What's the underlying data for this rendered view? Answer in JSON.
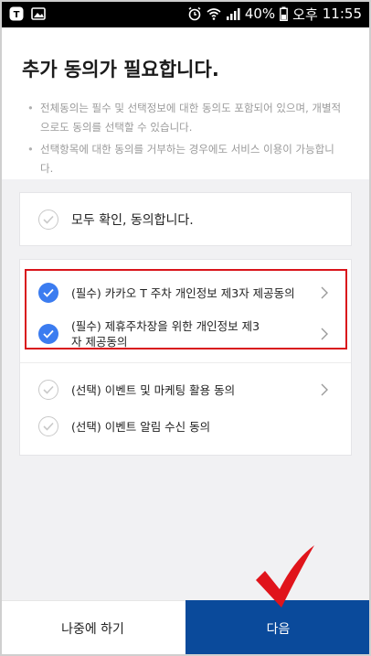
{
  "status_bar": {
    "battery": "40%",
    "time_period": "오후",
    "time": "11:55"
  },
  "title": "추가 동의가 필요합니다.",
  "notes": [
    "전체동의는 필수 및 선택정보에 대한 동의도 포함되어 있으며, 개별적으로도 동의를 선택할 수 있습니다.",
    "선택항목에 대한 동의를 거부하는 경우에도 서비스 이용이 가능합니다."
  ],
  "agree_all": {
    "label": "모두 확인, 동의합니다.",
    "checked": false
  },
  "consents": [
    {
      "label": "(필수) 카카오 T 주차 개인정보 제3자 제공동의",
      "checked": true,
      "has_detail": true
    },
    {
      "label": "(필수) 제휴주차장을 위한 개인정보 제3자 제공동의",
      "checked": true,
      "has_detail": true
    },
    {
      "label": "(선택) 이벤트 및 마케팅 활용 동의",
      "checked": false,
      "has_detail": true
    },
    {
      "label": "(선택) 이벤트 알림 수신 동의",
      "checked": false,
      "has_detail": false
    }
  ],
  "buttons": {
    "later": "나중에 하기",
    "next": "다음"
  },
  "colors": {
    "checked": "#3b7cf0",
    "primary_button": "#0a4a9b",
    "annotation": "#d9141b"
  }
}
